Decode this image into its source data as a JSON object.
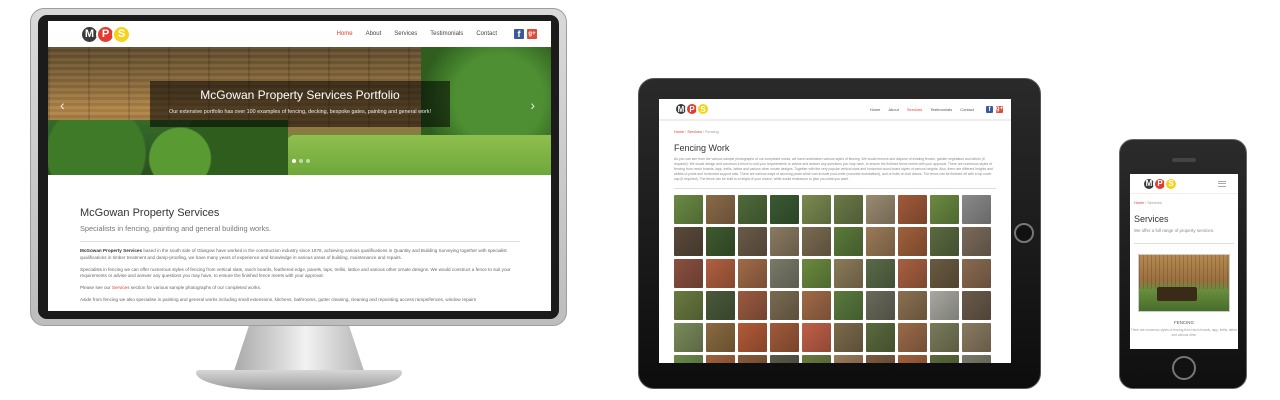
{
  "desktop": {
    "logo": [
      "M",
      "P",
      "S"
    ],
    "menu": [
      {
        "label": "Home",
        "active": true
      },
      {
        "label": "About",
        "active": false
      },
      {
        "label": "Services",
        "active": false
      },
      {
        "label": "Testimonials",
        "active": false
      },
      {
        "label": "Contact",
        "active": false
      }
    ],
    "social": {
      "facebook": "f",
      "googleplus": "g+"
    },
    "slider": {
      "title": "McGowan Property Services Portfolio",
      "subtitle": "Our extensive portfolio has over 100 examples of fencing, decking, bespoke gates, painting and general work!",
      "prev": "‹",
      "next": "›",
      "slides": 3,
      "active_slide": 1
    },
    "heading": "McGowan Property Services",
    "tagline": "Specialists in fencing, painting and general building works.",
    "para1_strong": "McGowan Property Services",
    "para1": " based in the south side of Glasgow have worked in the construction industry since 1976, achieving various qualifications in Quantity and Building Surveying together with specialist qualifications in timber treatment and damp-proofing, we have many years of experience and knowledge in various areas of building, maintenance and repairs.",
    "para2": "Specialists in fencing we can offer numerous styles of fencing from vertical slats, ranch boards, feathered edge, panels, laps, trellis, lattice and various other ornate designs. We would construct a fence to suit your requirements or advise and answer any questions you may have, to ensure the finished fence meets with your approval.",
    "para3_pre": "Please see our ",
    "para3_link": "Services",
    "para3_post": " section for various sample photographs of our completed works.",
    "para4": "Aside from fencing we also specialise in painting and general works including small extensions, kitchens, bathrooms, gutter cleaning, cleaning and repointing access ramps/fences, window repairs"
  },
  "tablet": {
    "logo": [
      "M",
      "P",
      "S"
    ],
    "menu": [
      {
        "label": "Home",
        "active": false
      },
      {
        "label": "About",
        "active": false
      },
      {
        "label": "Services",
        "active": true
      },
      {
        "label": "Testimonials",
        "active": false
      },
      {
        "label": "Contact",
        "active": false
      }
    ],
    "social": {
      "facebook": "f",
      "googleplus": "g+"
    },
    "breadcrumb": {
      "home": "Home",
      "sep1": " / ",
      "services": "Services",
      "sep2": " / ",
      "current": "Fencing"
    },
    "title": "Fencing Work",
    "intro": "As you can see from the various sample photographs of our completed works, we have undertaken various styles of fencing. We would remove and dispose of existing fences, garden vegetation and debris (if required). We would design and construct a fence to suit your requirements or advise and answer any questions you may have, to ensure the finished fence meets with your approval. There are numerous styles of fencing from ranch boards, lapp, trellis, lattice and various other ornate designs. Together with the very popular vertical slats and horizontal wood board styles of various heights. Also, there are different heights and widths of posts and horizontal support rails. There are various ways of securing posts which can include post-crete (concrete foundations), and or bolts on bolt downs. The fence can be finished off with a top cover cap (if required). The fence can be built to a height of your choice, while would endeavour to give you what you want.",
    "gallery_colors": [
      "#6b8a45",
      "#8a6a48",
      "#4e6b3a",
      "#3a5a32",
      "#7a8a50",
      "#6a7a48",
      "#9a8a70",
      "#a05a3a",
      "#6a8a40",
      "#8a8a8a",
      "#5a4a3a",
      "#3e5a2e",
      "#6a5a48",
      "#8a7a60",
      "#7a6a50",
      "#5a7a3a",
      "#9a7a58",
      "#a0603a",
      "#5a6a40",
      "#7a6a5a",
      "#8a5040",
      "#b06040",
      "#a06a48",
      "#7a7a6a",
      "#6a8a3e",
      "#8a7a58",
      "#5a6a48",
      "#a86040",
      "#6a5a40",
      "#8a6a50",
      "#6a7a40",
      "#4a5a3a",
      "#9a5a40",
      "#7a6a50",
      "#a06a48",
      "#5a7a3e",
      "#6a6a5a",
      "#8a7050",
      "#a8a8a0",
      "#6a5a4a",
      "#7a8a5a",
      "#8a6a40",
      "#b25a38",
      "#a05a3a",
      "#c06048",
      "#7a6a4a",
      "#5a6a3e",
      "#9a6a48",
      "#7a7a5a",
      "#8a7a60",
      "#6a8a4a",
      "#a0603c",
      "#8a5a3a",
      "#5a5a4a",
      "#6a7a3e",
      "#9a7a5a",
      "#7a5a40",
      "#a0603a",
      "#5a6a3a",
      "#7a7a6a"
    ]
  },
  "phone": {
    "logo": [
      "M",
      "P",
      "S"
    ],
    "breadcrumb": {
      "home": "Home",
      "sep": " / ",
      "current": "Services"
    },
    "title": "Services",
    "subtitle": "We offer a full range of property services.",
    "card_title": "FENCING",
    "card_text": "There are numerous styles of fencing from ranch boards, lapp, trellis, lattice and various other"
  }
}
